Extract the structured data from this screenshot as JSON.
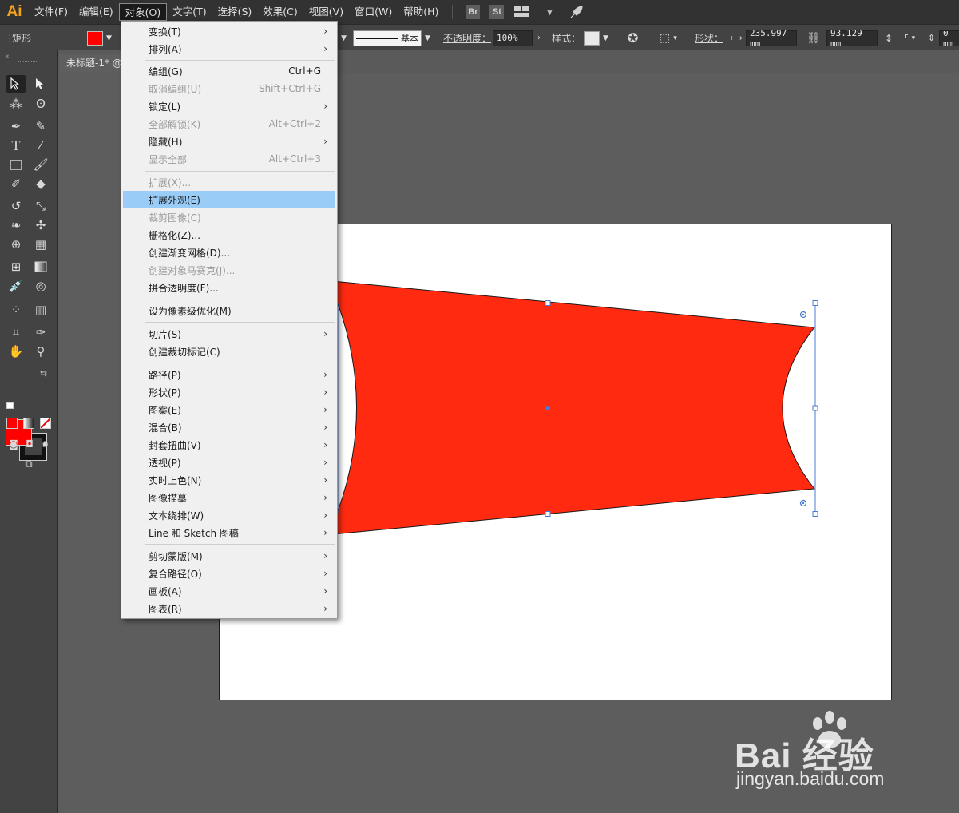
{
  "app": {
    "logo": "Ai"
  },
  "menubar": {
    "items": [
      "文件(F)",
      "编辑(E)",
      "对象(O)",
      "文字(T)",
      "选择(S)",
      "效果(C)",
      "视图(V)",
      "窗口(W)",
      "帮助(H)"
    ],
    "active_index": 2,
    "right_icons": [
      {
        "name": "bridge-icon",
        "label": "Br"
      },
      {
        "name": "stock-icon",
        "label": "St"
      }
    ]
  },
  "controlbar": {
    "object_type": "矩形",
    "fill_color": "#ff0000",
    "stroke_profile": "基本",
    "opacity_label": "不透明度：",
    "opacity_value": "100%",
    "style_label": "样式：",
    "shape_label": "形状：",
    "width_value": "235.997 mm",
    "height_value": "93.129 mm",
    "corner_value": "0 mm"
  },
  "document": {
    "tab_title": "未标题-1* @"
  },
  "toolbar": {
    "fill_color": "#ff0000",
    "stroke_color": "#111111"
  },
  "dropdown": {
    "items": [
      {
        "label": "变换(T)",
        "submenu": true
      },
      {
        "label": "排列(A)",
        "submenu": true
      },
      {
        "label": "编组(G)",
        "shortcut": "Ctrl+G"
      },
      {
        "label": "取消编组(U)",
        "shortcut": "Shift+Ctrl+G",
        "disabled": true
      },
      {
        "label": "锁定(L)",
        "submenu": true
      },
      {
        "label": "全部解锁(K)",
        "shortcut": "Alt+Ctrl+2",
        "disabled": true
      },
      {
        "label": "隐藏(H)",
        "submenu": true
      },
      {
        "label": "显示全部",
        "shortcut": "Alt+Ctrl+3",
        "disabled": true
      },
      {
        "label": "扩展(X)...",
        "disabled": true
      },
      {
        "label": "扩展外观(E)",
        "highlight": true
      },
      {
        "label": "裁剪图像(C)",
        "disabled": true
      },
      {
        "label": "栅格化(Z)..."
      },
      {
        "label": "创建渐变网格(D)..."
      },
      {
        "label": "创建对象马赛克(J)...",
        "disabled": true
      },
      {
        "label": "拼合透明度(F)..."
      },
      {
        "label": "设为像素级优化(M)"
      },
      {
        "label": "切片(S)",
        "submenu": true
      },
      {
        "label": "创建裁切标记(C)"
      },
      {
        "label": "路径(P)",
        "submenu": true
      },
      {
        "label": "形状(P)",
        "submenu": true
      },
      {
        "label": "图案(E)",
        "submenu": true
      },
      {
        "label": "混合(B)",
        "submenu": true
      },
      {
        "label": "封套扭曲(V)",
        "submenu": true
      },
      {
        "label": "透视(P)",
        "submenu": true
      },
      {
        "label": "实时上色(N)",
        "submenu": true
      },
      {
        "label": "图像描摹",
        "submenu": true
      },
      {
        "label": "文本绕排(W)",
        "submenu": true
      },
      {
        "label": "Line 和 Sketch 图稿",
        "submenu": true
      },
      {
        "label": "剪切蒙版(M)",
        "submenu": true
      },
      {
        "label": "复合路径(O)",
        "submenu": true
      },
      {
        "label": "画板(A)",
        "submenu": true
      },
      {
        "label": "图表(R)",
        "submenu": true
      }
    ]
  },
  "artwork": {
    "shape_fill": "#ff2a10",
    "selection_color": "#4a7bd6"
  },
  "watermark": {
    "brand": "Bai 经验",
    "url": "jingyan.baidu.com"
  }
}
